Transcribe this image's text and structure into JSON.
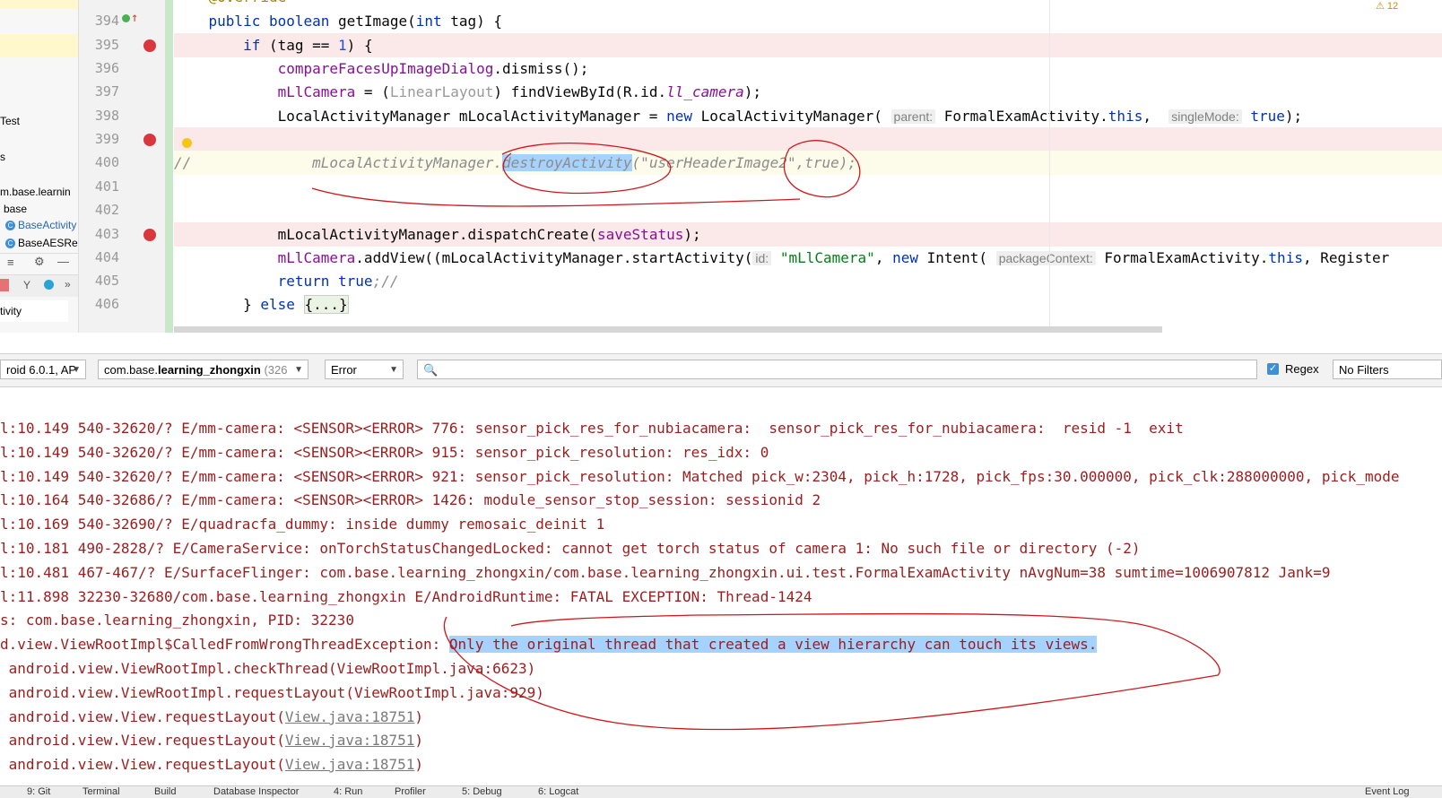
{
  "project": {
    "items": [
      {
        "label": "Test",
        "icon": null
      },
      {
        "label": "s",
        "icon": null
      },
      {
        "label": "m.base.learnin",
        "icon": null
      },
      {
        "label": "base",
        "icon": null
      },
      {
        "label": "BaseActivity",
        "icon": "class-icon"
      },
      {
        "label": "BaseAESRe",
        "icon": "class-icon"
      }
    ],
    "tab_label": "tivity"
  },
  "editor": {
    "warning_count": "12",
    "lines": [
      {
        "num": "394",
        "breakpoint": false
      },
      {
        "num": "395",
        "breakpoint": true
      },
      {
        "num": "396",
        "breakpoint": false
      },
      {
        "num": "397",
        "breakpoint": false
      },
      {
        "num": "398",
        "breakpoint": false
      },
      {
        "num": "399",
        "breakpoint": true
      },
      {
        "num": "400",
        "breakpoint": false
      },
      {
        "num": "401",
        "breakpoint": false
      },
      {
        "num": "402",
        "breakpoint": false
      },
      {
        "num": "403",
        "breakpoint": true
      },
      {
        "num": "404",
        "breakpoint": false
      },
      {
        "num": "405",
        "breakpoint": false
      },
      {
        "num": "406",
        "breakpoint": false
      }
    ],
    "code": {
      "l394": "public boolean getImage(int tag) {",
      "l395_a": "if (tag == ",
      "l395_num": "1",
      "l395_b": ") {",
      "l396_fld": "compareFacesUpImageDialog",
      "l396_b": ".dismiss();",
      "l397_fld": "mLlCamera",
      "l397_b": " = (",
      "l397_typ": "LinearLayout",
      "l397_c": ") findViewById(R.id.",
      "l397_id": "ll_camera",
      "l397_d": ");",
      "l398_a": "LocalActivityManager mLocalActivityManager = ",
      "l398_new": "new",
      "l398_b": " LocalActivityManager(",
      "l398_hint1": "parent:",
      "l398_c": " FormalExamActivity.",
      "l398_this": "this",
      "l398_d": ",  ",
      "l398_hint2": "singleMode:",
      "l398_e": " ",
      "l398_true": "true",
      "l398_f": ");",
      "l400_comment": "//",
      "l400_a": "mLocalActivityManager.",
      "l400_sel": "destroyActivity",
      "l400_b": "(\"userHeaderImage2\",true);",
      "l403_a": "mLocalActivityManager.dispatchCreate(",
      "l403_fld": "saveStatus",
      "l403_b": ");",
      "l404_fld": "mLlCamera",
      "l404_a": ".addView((mLocalActivityManager.startActivity(",
      "l404_hint1": "id:",
      "l404_str": "\"mLlCamera\"",
      "l404_b": ", ",
      "l404_new": "new",
      "l404_c": " Intent(",
      "l404_hint2": "packageContext:",
      "l404_d": " FormalExamActivity.",
      "l404_this": "this",
      "l404_e": ", Register",
      "l405_kw": "return",
      "l405_true": "true",
      "l405_cmt": ";//",
      "l406_a": "} ",
      "l406_kw": "else",
      "l406_fold": "{...}"
    }
  },
  "logcat": {
    "device": "roid 6.0.1, AP",
    "process_bold_prefix": "com.base.",
    "process_bold": "learning_zhongxin",
    "process_pid": " (326 ",
    "level": "Error",
    "search_placeholder": "",
    "regex_label": "Regex",
    "regex_checked": true,
    "filter": "No Filters",
    "lines": [
      "l:10.149 540-32620/? E/mm-camera: <SENSOR><ERROR> 776: sensor_pick_res_for_nubiacamera:  sensor_pick_res_for_nubiacamera:  resid -1  exit",
      "l:10.149 540-32620/? E/mm-camera: <SENSOR><ERROR> 915: sensor_pick_resolution: res_idx: 0",
      "l:10.149 540-32620/? E/mm-camera: <SENSOR><ERROR> 921: sensor_pick_resolution: Matched pick_w:2304, pick_h:1728, pick_fps:30.000000, pick_clk:288000000, pick_mode",
      "l:10.164 540-32686/? E/mm-camera: <SENSOR><ERROR> 1426: module_sensor_stop_session: sessionid 2",
      "l:10.169 540-32690/? E/quadracfa_dummy: inside dummy remosaic_deinit 1",
      "l:10.181 490-2828/? E/CameraService: onTorchStatusChangedLocked: cannot get torch status of camera 1: No such file or directory (-2)",
      "l:10.481 467-467/? E/SurfaceFlinger: com.base.learning_zhongxin/com.base.learning_zhongxin.ui.test.FormalExamActivity nAvgNum=38 sumtime=1006907812 Jank=9",
      "l:11.898 32230-32680/com.base.learning_zhongxin E/AndroidRuntime: FATAL EXCEPTION: Thread-1424",
      "s: com.base.learning_zhongxin, PID: 32230"
    ],
    "exc_prefix": "d.view.ViewRootImpl$CalledFromWrongThreadException: ",
    "exc_msg": "Only the original thread that created a view hierarchy can touch its views.",
    "stack": [
      {
        "text": " android.view.ViewRootImpl.checkThread(ViewRootImpl.java:6623)",
        "link": "",
        "tail": ""
      },
      {
        "text": " android.view.ViewRootImpl.requestLayout(ViewRootImpl.java:929)",
        "link": "",
        "tail": ""
      },
      {
        "text": " android.view.View.requestLayout(",
        "link": "View.java:18751",
        "tail": ")"
      },
      {
        "text": " android.view.View.requestLayout(",
        "link": "View.java:18751",
        "tail": ")"
      },
      {
        "text": " android.view.View.requestLayout(",
        "link": "View.java:18751",
        "tail": ")"
      }
    ]
  },
  "bottom_bar": {
    "items": [
      "9: Git",
      "Terminal",
      "Build",
      "Database Inspector",
      "4: Run",
      "Profiler",
      "5: Debug",
      "6: Logcat"
    ],
    "right": "Event Log"
  },
  "colors": {
    "breakpoint": "#d9363e",
    "annotation": "#d0161b",
    "selection": "#a6d2ff",
    "log_error": "#9b1d1d"
  }
}
